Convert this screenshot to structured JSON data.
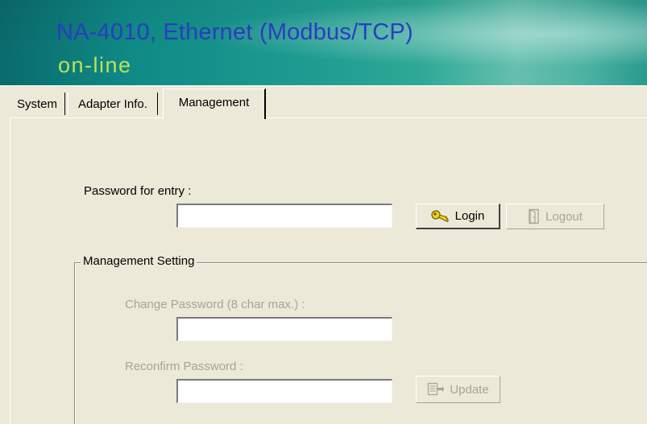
{
  "header": {
    "title": "NA-4010, Ethernet (Modbus/TCP)",
    "status": "on-line"
  },
  "tabs": [
    {
      "label": "System",
      "selected": false
    },
    {
      "label": "Adapter Info.",
      "selected": false
    },
    {
      "label": "Management",
      "selected": true
    }
  ],
  "login": {
    "password_label": "Password for entry :",
    "password_value": "",
    "login_label": "Login",
    "logout_label": "Logout"
  },
  "management": {
    "group_title": "Management Setting",
    "change_label": "Change Password (8 char max.) :",
    "change_value": "",
    "reconfirm_label": "Reconfirm Password :",
    "reconfirm_value": "",
    "update_label": "Update"
  },
  "icons": {
    "login": "key-icon",
    "logout": "door-icon",
    "update": "update-icon"
  },
  "colors": {
    "title": "#2b3cc0",
    "status": "#b9e25a",
    "window_bg": "#ece9d8",
    "disabled_text": "#a7a497"
  }
}
